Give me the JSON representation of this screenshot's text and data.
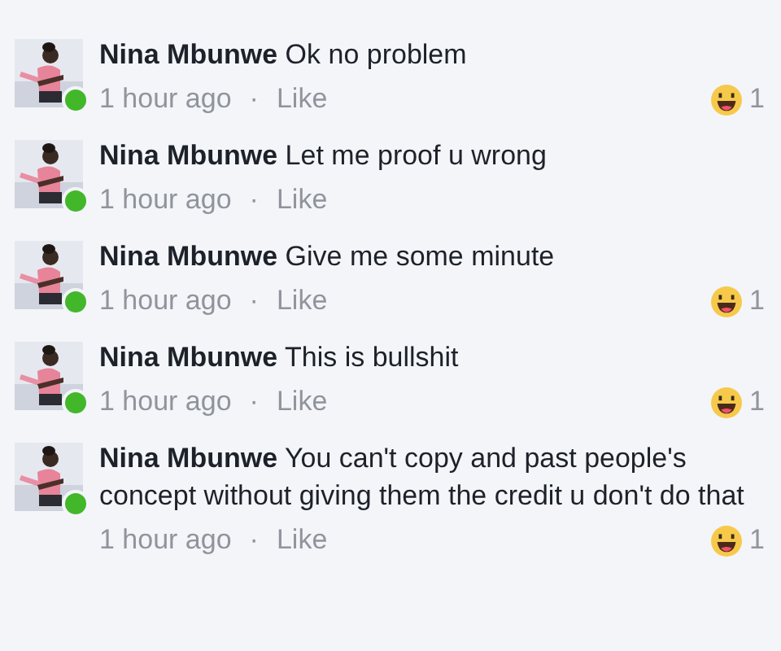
{
  "comments": [
    {
      "author": "Nina Mbunwe",
      "text": "Ok no problem",
      "online": true,
      "time": "1 hour ago",
      "separator": "·",
      "action": "Like",
      "reaction_count": "1"
    },
    {
      "author": "Nina Mbunwe",
      "text": "Let me proof u wrong",
      "online": true,
      "time": "1 hour ago",
      "separator": "·",
      "action": "Like"
    },
    {
      "author": "Nina Mbunwe",
      "text": "Give me some minute",
      "online": true,
      "time": "1 hour ago",
      "separator": "·",
      "action": "Like",
      "reaction_count": "1"
    },
    {
      "author": "Nina Mbunwe",
      "text": "This is bullshit",
      "online": true,
      "time": "1 hour ago",
      "separator": "·",
      "action": "Like",
      "reaction_count": "1"
    },
    {
      "author": "Nina Mbunwe",
      "text": "You can't copy and past people's concept without giving them the credit u don't do that",
      "online": true,
      "time": "1 hour ago",
      "separator": "·",
      "action": "Like",
      "reaction_count": "1"
    }
  ]
}
